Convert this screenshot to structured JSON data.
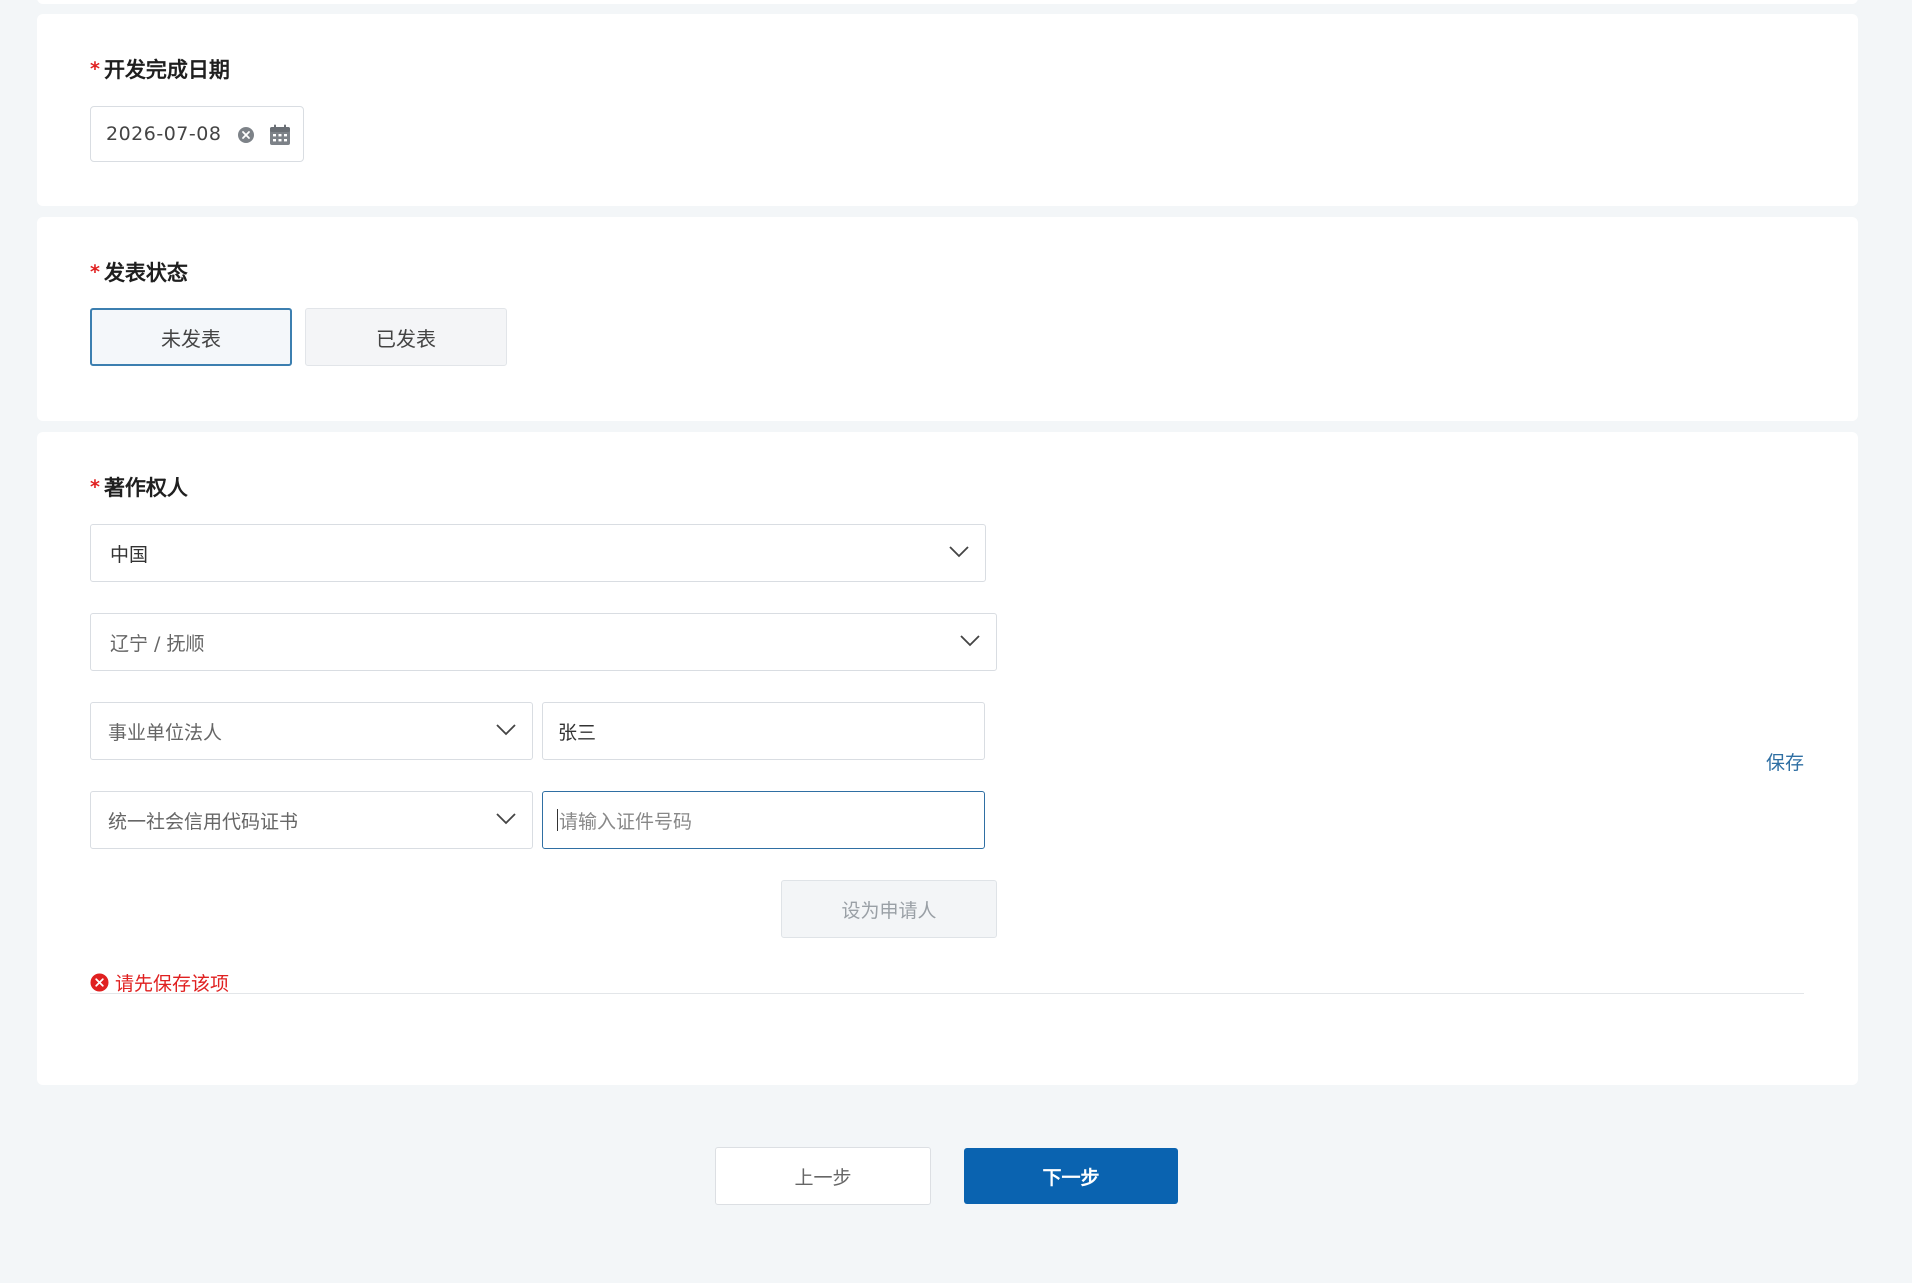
{
  "date_section": {
    "required_mark": "*",
    "label": "开发完成日期",
    "value": "2026-07-08",
    "clear_icon": "clear-circle-icon",
    "calendar_icon": "calendar-icon"
  },
  "publish_section": {
    "required_mark": "*",
    "label": "发表状态",
    "options": [
      {
        "label": "未发表",
        "selected": true
      },
      {
        "label": "已发表",
        "selected": false
      }
    ]
  },
  "owner_section": {
    "required_mark": "*",
    "label": "著作权人",
    "country": "中国",
    "region": "辽宁 / 抚顺",
    "entity_type": "事业单位法人",
    "name": "张三",
    "id_type": "统一社会信用代码证书",
    "id_number_placeholder": "请输入证件号码",
    "save_link": "保存",
    "set_applicant_button": "设为申请人",
    "error_text": "请先保存该项"
  },
  "footer": {
    "prev_button": "上一步",
    "next_button": "下一步"
  },
  "colors": {
    "primary": "#0a63b0",
    "link": "#2f6fa3",
    "error": "#e02020",
    "page_bg": "#f3f6f8"
  }
}
